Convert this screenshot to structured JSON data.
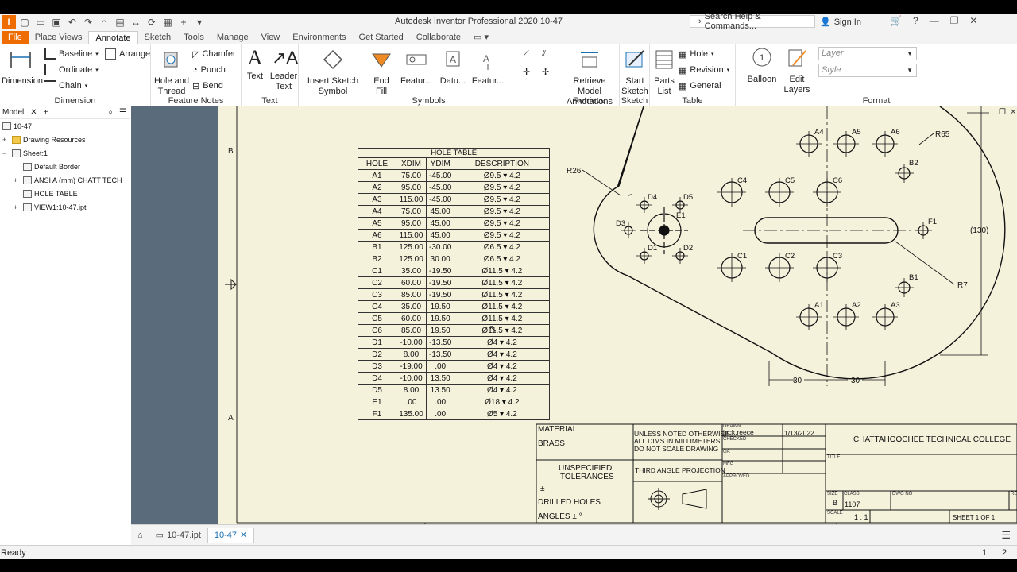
{
  "window": {
    "title": "Autodesk Inventor Professional 2020    10-47",
    "app_icon": "I PRO"
  },
  "search": {
    "placeholder": "Search Help & Commands..."
  },
  "account": {
    "signin": "Sign In"
  },
  "ribbon_tabs": [
    "File",
    "Place Views",
    "Annotate",
    "Sketch",
    "Tools",
    "Manage",
    "View",
    "Environments",
    "Get Started",
    "Collaborate"
  ],
  "active_tab": "Annotate",
  "ribbon": {
    "dimension": {
      "label": "Dimension",
      "big": "Dimension",
      "baseline": "Baseline",
      "arrange": "Arrange",
      "ordinate": "Ordinate",
      "chain": "Chain"
    },
    "feature_notes": {
      "label": "Feature Notes",
      "hole_thread": "Hole and Thread",
      "chamfer": "Chamfer",
      "punch": "Punch",
      "bend": "Bend"
    },
    "text": {
      "label": "Text",
      "text": "Text",
      "leader_text": "Leader Text"
    },
    "symbols": {
      "label": "Symbols",
      "insert_sketch_symbol": "Insert Sketch Symbol",
      "end_fill": "End Fill",
      "feature1": "Featur...",
      "datum": "Datu...",
      "feature2": "Featur..."
    },
    "retrieve": {
      "label": "Retrieve",
      "retrieve_model_annotations": "Retrieve Model Annotations"
    },
    "sketch": {
      "label": "Sketch",
      "start_sketch": "Start Sketch"
    },
    "table": {
      "label": "Table",
      "parts_list": "Parts List",
      "hole": "Hole",
      "revision": "Revision",
      "general": "General"
    },
    "format": {
      "label": "Format",
      "balloon": "Balloon",
      "edit_layers": "Edit Layers",
      "layer": "Layer",
      "style": "Style"
    }
  },
  "browser": {
    "tab": "Model",
    "items": [
      {
        "label": "10-47"
      },
      {
        "label": "Drawing Resources"
      },
      {
        "label": "Sheet:1"
      },
      {
        "label": "Default Border"
      },
      {
        "label": "ANSI A (mm) CHATT TECH"
      },
      {
        "label": "HOLE TABLE"
      },
      {
        "label": "VIEW1:10-47.ipt"
      }
    ]
  },
  "hole_table": {
    "title": "HOLE TABLE",
    "headers": [
      "HOLE",
      "XDIM",
      "YDIM",
      "DESCRIPTION"
    ],
    "rows": [
      [
        "A1",
        "75.00",
        "-45.00",
        "Ø9.5 ▾ 4.2"
      ],
      [
        "A2",
        "95.00",
        "-45.00",
        "Ø9.5 ▾ 4.2"
      ],
      [
        "A3",
        "115.00",
        "-45.00",
        "Ø9.5 ▾ 4.2"
      ],
      [
        "A4",
        "75.00",
        "45.00",
        "Ø9.5 ▾ 4.2"
      ],
      [
        "A5",
        "95.00",
        "45.00",
        "Ø9.5 ▾ 4.2"
      ],
      [
        "A6",
        "115.00",
        "45.00",
        "Ø9.5 ▾ 4.2"
      ],
      [
        "B1",
        "125.00",
        "-30.00",
        "Ø6.5 ▾ 4.2"
      ],
      [
        "B2",
        "125.00",
        "30.00",
        "Ø6.5 ▾ 4.2"
      ],
      [
        "C1",
        "35.00",
        "-19.50",
        "Ø11.5 ▾ 4.2"
      ],
      [
        "C2",
        "60.00",
        "-19.50",
        "Ø11.5 ▾ 4.2"
      ],
      [
        "C3",
        "85.00",
        "-19.50",
        "Ø11.5 ▾ 4.2"
      ],
      [
        "C4",
        "35.00",
        "19.50",
        "Ø11.5 ▾ 4.2"
      ],
      [
        "C5",
        "60.00",
        "19.50",
        "Ø11.5 ▾ 4.2"
      ],
      [
        "C6",
        "85.00",
        "19.50",
        "Ø11.5 ▾ 4.2"
      ],
      [
        "D1",
        "-10.00",
        "-13.50",
        "Ø4 ▾ 4.2"
      ],
      [
        "D2",
        "8.00",
        "-13.50",
        "Ø4 ▾ 4.2"
      ],
      [
        "D3",
        "-19.00",
        ".00",
        "Ø4 ▾ 4.2"
      ],
      [
        "D4",
        "-10.00",
        "13.50",
        "Ø4 ▾ 4.2"
      ],
      [
        "D5",
        "8.00",
        "13.50",
        "Ø4 ▾ 4.2"
      ],
      [
        "E1",
        ".00",
        ".00",
        "Ø18 ▾ 4.2"
      ],
      [
        "F1",
        "135.00",
        ".00",
        "Ø5 ▾ 4.2"
      ]
    ]
  },
  "border": {
    "zone_b": "B",
    "zone_a": "A",
    "col_4": "4",
    "col_3": "3",
    "col_2": "2",
    "col_1": "1"
  },
  "drawing": {
    "r65": "R65",
    "r26": "R26",
    "r7": "R7",
    "dim_130": "(130)",
    "dim_30a": "30",
    "dim_30b": "30",
    "labels": {
      "A1": "A1",
      "A2": "A2",
      "A3": "A3",
      "A4": "A4",
      "A5": "A5",
      "A6": "A6",
      "B1": "B1",
      "B2": "B2",
      "C1": "C1",
      "C2": "C2",
      "C3": "C3",
      "C4": "C4",
      "C5": "C5",
      "C6": "C6",
      "D1": "D1",
      "D2": "D2",
      "D3": "D3",
      "D4": "D4",
      "D5": "D5",
      "E1": "E1",
      "F1": "F1"
    }
  },
  "title_block": {
    "material_label": "MATERIAL",
    "material": "BRASS",
    "unspecified": "UNSPECIFIED",
    "tolerances": "TOLERANCES",
    "plusminus": "±",
    "drilled_holes": "DRILLED HOLES",
    "angles": "ANGLES ±  °",
    "unless_noted": "UNLESS NOTED OTHERWISE",
    "all_dims": "ALL DIMS IN MILLIMETERS",
    "no_scale": "DO NOT SCALE DRAWING",
    "projection": "THIRD ANGLE PROJECTION",
    "drawn_label": "DRAWN",
    "drawn_by": "jack.reece",
    "date": "1/13/2022",
    "checked_label": "CHECKED",
    "qa_label": "QA",
    "mfg_label": "MFG",
    "approved_label": "APPROVED",
    "company": "CHATTAHOOCHEE TECHNICAL COLLEGE",
    "title_label": "TITLE",
    "size_label": "SIZE",
    "size": "B",
    "class_label": "CLASS",
    "class": "1107",
    "dwg_no_label": "DWG NO",
    "rev_label": "RE",
    "scale_label": "SCALE",
    "scale": "1 : 1",
    "sheet": "SHEET  1   OF  1"
  },
  "doc_tabs": [
    {
      "label": "10-47.ipt"
    },
    {
      "label": "10-47"
    }
  ],
  "status": {
    "text": "Ready",
    "page_a": "1",
    "page_b": "2"
  },
  "colors": {
    "accent": "#ef6c00",
    "sheet": "#f5f2dc",
    "canvas": "#5a6b7b"
  }
}
